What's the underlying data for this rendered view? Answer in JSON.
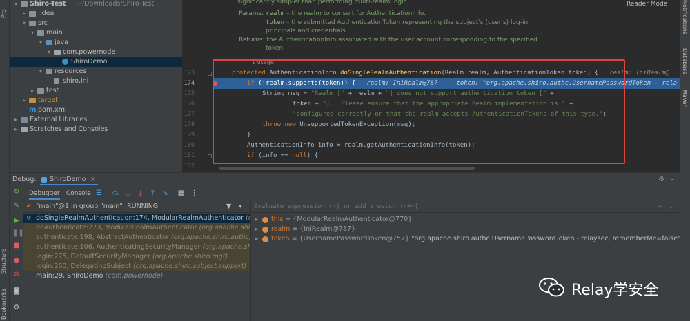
{
  "left_strip": {
    "project_label": "Pro",
    "structure_label": "Structure",
    "bookmarks_label": "Bookmarks"
  },
  "right_strip": {
    "notifications_label": "Notifications",
    "database_label": "Database",
    "maven_label": "Maven"
  },
  "project_tree": [
    {
      "label": "Shiro-Test",
      "extra": "~/Downloads/Shiro-Test",
      "icon": "folder-icon",
      "expanded": true,
      "depth": 0
    },
    {
      "label": ".idea",
      "icon": "folder-icon",
      "expanded": false,
      "depth": 1
    },
    {
      "label": "src",
      "icon": "folder-icon",
      "expanded": true,
      "depth": 1
    },
    {
      "label": "main",
      "icon": "folder-icon",
      "expanded": true,
      "depth": 2
    },
    {
      "label": "java",
      "icon": "source-folder-icon",
      "expanded": true,
      "depth": 3
    },
    {
      "label": "com.powernode",
      "icon": "package-icon",
      "expanded": true,
      "depth": 4
    },
    {
      "label": "ShiroDemo",
      "icon": "java-class-icon",
      "expanded": null,
      "depth": 5,
      "selected": true
    },
    {
      "label": "resources",
      "icon": "resources-folder-icon",
      "expanded": true,
      "depth": 3
    },
    {
      "label": "shiro.ini",
      "icon": "ini-file-icon",
      "expanded": null,
      "depth": 4
    },
    {
      "label": "test",
      "icon": "folder-icon",
      "expanded": false,
      "depth": 2
    },
    {
      "label": "target",
      "icon": "excluded-folder-icon",
      "expanded": false,
      "depth": 1,
      "orange": true
    },
    {
      "label": "pom.xml",
      "icon": "maven-file-icon",
      "expanded": null,
      "depth": 1
    },
    {
      "label": "External Libraries",
      "icon": "library-icon",
      "expanded": false,
      "depth": 0
    },
    {
      "label": "Scratches and Consoles",
      "icon": "scratch-icon",
      "expanded": false,
      "depth": 0
    }
  ],
  "editor": {
    "reader_mode": "Reader Mode",
    "doc": {
      "line1": "significantly simpler than performing multi-realm logic.",
      "params_tag": "Params:",
      "param1_name": "realm",
      "param1_desc": " – the realm to consult for AuthenticationInfo.",
      "param2_name": "token",
      "param2_desc": " – the submitted AuthenticationToken representing the subject's (user's) log-in",
      "param2_desc2": "principals and credentials.",
      "returns_tag": "Returns:",
      "returns_desc": "the AuthenticationInfo associated with the user account corresponding to the specified",
      "returns_desc2": "token"
    },
    "usage": "1 usage",
    "lines": [
      {
        "num": "173"
      },
      {
        "num": "174"
      },
      {
        "num": "175"
      },
      {
        "num": "176"
      },
      {
        "num": "177"
      },
      {
        "num": "178"
      },
      {
        "num": "179"
      },
      {
        "num": "180"
      },
      {
        "num": "181"
      },
      {
        "num": "182"
      }
    ],
    "code": {
      "l173_kw": "protected ",
      "l173_type": "AuthenticationInfo ",
      "l173_fn": "doSingleRealmAuthentication",
      "l173_rest": "(Realm realm, AuthenticationToken token) {",
      "l173_hint": "   realm: IniRealm@",
      "l174_kw": "if ",
      "l174_code": "(!realm.supports(token)) {",
      "l174_hint": "   realm: IniRealm@787     token: \"org.apache.shiro.authc.UsernamePasswordToken - rela",
      "l175_a": "String msg = ",
      "l175_s1": "\"Realm [\"",
      "l175_b": " + realm + ",
      "l175_s2": "\"] does not support authentication token [\"",
      "l175_c": " +",
      "l176_a": "token + ",
      "l176_s": "\"].  Please ensure that the appropriate Realm implementation is \"",
      "l176_c": " +",
      "l177_s": "\"configured correctly or that the realm accepts AuthenticationTokens of this type.\"",
      "l177_c": ";",
      "l178_kw1": "throw new ",
      "l178_code": "UnsupportedTokenException(msg);",
      "l179": "}",
      "l180": "AuthenticationInfo info = realm.getAuthenticationInfo(token);",
      "l181_kw": "if ",
      "l181_a": "(info == ",
      "l181_kw2": "null",
      "l181_b": ") {"
    }
  },
  "debug": {
    "title": "Debug:",
    "tab": "ShiroDemo",
    "tab_close": "×",
    "subtabs": [
      "Debugger",
      "Console"
    ],
    "thread": "\"main\"@1 in group \"main\": RUNNING",
    "frames": [
      {
        "method": "doSingleRealmAuthentication:174, ModularRealmAuthenticator",
        "loc": "(org.apach",
        "kind": "selected"
      },
      {
        "method": "doAuthenticate:273, ModularRealmAuthenticator",
        "loc": "(org.apache.shiro.authc",
        "kind": "lib"
      },
      {
        "method": "authenticate:198, AbstractAuthenticator",
        "loc": "(org.apache.shiro.authc)",
        "kind": "lib"
      },
      {
        "method": "authenticate:106, AuthenticatingSecurityManager",
        "loc": "(org.apache.shiro.mgt)",
        "kind": "lib"
      },
      {
        "method": "login:275, DefaultSecurityManager",
        "loc": "(org.apache.shiro.mgt)",
        "kind": "lib"
      },
      {
        "method": "login:260, DelegatingSubject",
        "loc": "(org.apache.shiro.subject.support)",
        "kind": "lib"
      },
      {
        "method": "main:29, ShiroDemo",
        "loc": "(com.powernode)",
        "kind": "normal"
      }
    ],
    "eval_placeholder": "Evaluate expression (⏎) or add a watch (⇧⌘⏎)",
    "variables": [
      {
        "name": "this",
        "value": "{ModularRealmAuthenticator@770}",
        "extra": ""
      },
      {
        "name": "realm",
        "value": "{IniRealm@787}",
        "extra": ""
      },
      {
        "name": "token",
        "value": "{UsernamePasswordToken@757}",
        "extra": " \"org.apache.shiro.authc.UsernamePasswordToken - relaysec, rememberMe=false\""
      }
    ]
  },
  "watermark": {
    "text": "Relay学安全"
  },
  "colors": {
    "accent": "#4a88c7",
    "selection": "#2d6099",
    "highlight_box": "#e0443e",
    "keyword": "#cc7832",
    "string": "#6a8759"
  }
}
